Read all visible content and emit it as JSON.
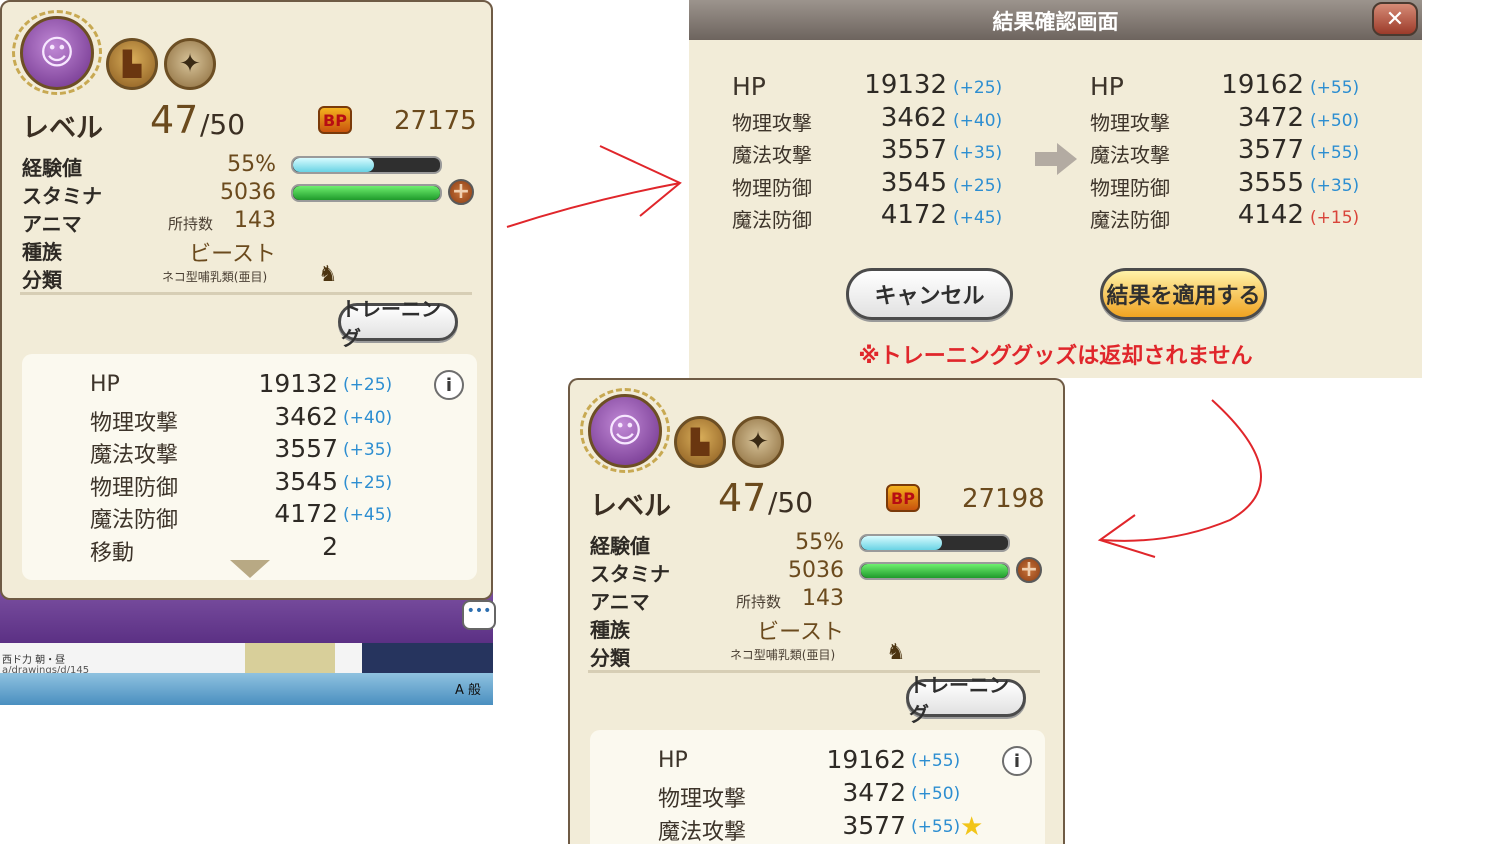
{
  "left_panel": {
    "level_label": "レベル",
    "level": "47",
    "level_max": "/50",
    "bp_badge": "BP",
    "bp_value": "27175",
    "exp_label": "経験値",
    "exp_value": "55%",
    "exp_fraction": 0.55,
    "stamina_label": "スタミナ",
    "stamina_value": "5036",
    "anima_label": "アニマ",
    "anima_sub": "所持数",
    "anima_value": "143",
    "race_label": "種族",
    "race_value": "ビースト",
    "class_label": "分類",
    "class_value": "ネコ型哺乳類(亜目)",
    "training_button": "トレーニング",
    "stats": [
      {
        "label": "HP",
        "value": "19132",
        "delta": "(+25)"
      },
      {
        "label": "物理攻撃",
        "value": "3462",
        "delta": "(+40)"
      },
      {
        "label": "魔法攻撃",
        "value": "3557",
        "delta": "(+35)"
      },
      {
        "label": "物理防御",
        "value": "3545",
        "delta": "(+25)"
      },
      {
        "label": "魔法防御",
        "value": "4172",
        "delta": "(+45)"
      },
      {
        "label": "移動",
        "value": "2"
      }
    ],
    "info_icon": "i"
  },
  "taskbar": {
    "text1": "西ド力 朝・昼",
    "text2": "a/drawings/d/145",
    "ime": "A 般"
  },
  "dialog": {
    "title": "結果確認画面",
    "close_icon": "✕",
    "before": [
      {
        "label": "HP",
        "value": "19132",
        "delta": "(+25)"
      },
      {
        "label": "物理攻撃",
        "value": "3462",
        "delta": "(+40)"
      },
      {
        "label": "魔法攻撃",
        "value": "3557",
        "delta": "(+35)"
      },
      {
        "label": "物理防御",
        "value": "3545",
        "delta": "(+25)"
      },
      {
        "label": "魔法防御",
        "value": "4172",
        "delta": "(+45)"
      }
    ],
    "after": [
      {
        "label": "HP",
        "value": "19162",
        "delta": "(+55)"
      },
      {
        "label": "物理攻撃",
        "value": "3472",
        "delta": "(+50)"
      },
      {
        "label": "魔法攻撃",
        "value": "3577",
        "delta": "(+55)"
      },
      {
        "label": "物理防御",
        "value": "3555",
        "delta": "(+35)"
      },
      {
        "label": "魔法防御",
        "value": "4142",
        "delta": "(+15)"
      }
    ],
    "cancel_button": "キャンセル",
    "apply_button": "結果を適用する",
    "notice": "※トレーニンググッズは返却されません"
  },
  "right_panel": {
    "level_label": "レベル",
    "level": "47",
    "level_max": "/50",
    "bp_badge": "BP",
    "bp_value": "27198",
    "exp_label": "経験値",
    "exp_value": "55%",
    "exp_fraction": 0.55,
    "stamina_label": "スタミナ",
    "stamina_value": "5036",
    "anima_label": "アニマ",
    "anima_sub": "所持数",
    "anima_value": "143",
    "race_label": "種族",
    "race_value": "ビースト",
    "class_label": "分類",
    "class_value": "ネコ型哺乳類(亜目)",
    "training_button": "トレーニング",
    "stats": [
      {
        "label": "HP",
        "value": "19162",
        "delta": "(+55)"
      },
      {
        "label": "物理攻撃",
        "value": "3472",
        "delta": "(+50)"
      },
      {
        "label": "魔法攻撃",
        "value": "3577",
        "delta": "(+55)"
      }
    ],
    "info_icon": "i"
  },
  "colors": {
    "panel_bg": "#f2ecd8",
    "delta_blue": "#2d8ed1",
    "delta_red": "#d9443a",
    "annotation_red": "#e0262b",
    "exp_bar": "#8fe8f0",
    "stamina_bar": "#2fb23a"
  }
}
